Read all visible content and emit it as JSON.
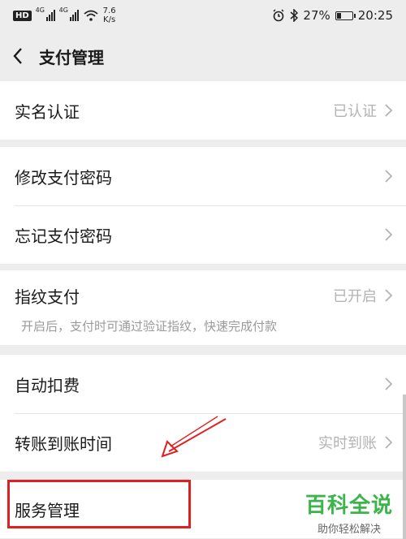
{
  "status_bar": {
    "hd": "HD",
    "net1": "4G",
    "net2": "4G",
    "speed_value": "7.6",
    "speed_unit": "K/s",
    "battery": "27%",
    "battery_level": 0.27,
    "time": "20:25"
  },
  "header": {
    "title": "支付管理"
  },
  "groups": [
    {
      "rows": [
        {
          "label": "实名认证",
          "value": "已认证"
        }
      ]
    },
    {
      "rows": [
        {
          "label": "修改支付密码",
          "value": ""
        },
        {
          "label": "忘记支付密码",
          "value": ""
        }
      ]
    },
    {
      "rows": [
        {
          "label": "指纹支付",
          "value": "已开启"
        }
      ],
      "description": "开启后，支付时可通过验证指纹，快速完成付款"
    },
    {
      "rows": [
        {
          "label": "自动扣费",
          "value": ""
        },
        {
          "label": "转账到账时间",
          "value": "实时到账"
        }
      ]
    },
    {
      "rows": [
        {
          "label": "服务管理",
          "value": ""
        }
      ]
    }
  ],
  "watermark": {
    "brand": "百科全说",
    "tagline": "助你轻松解决"
  },
  "colors": {
    "highlight": "#e02020",
    "watermark": "#3bb54a",
    "background": "#ededed"
  }
}
